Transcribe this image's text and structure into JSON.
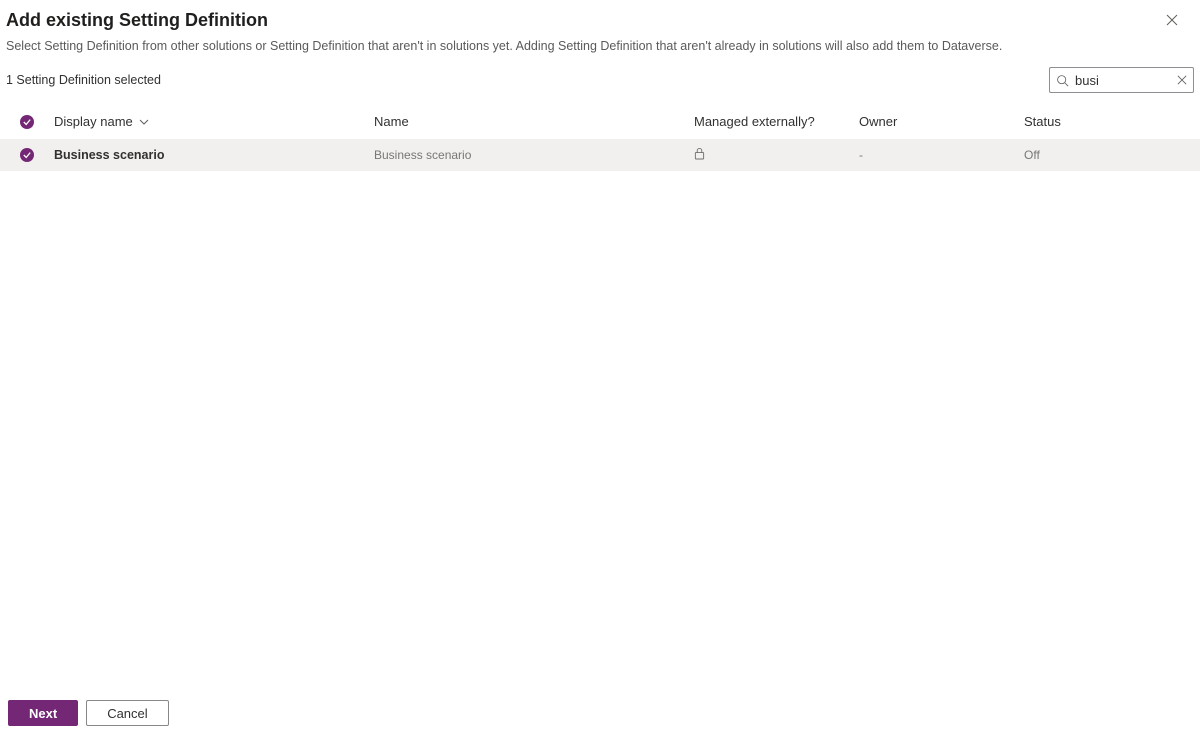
{
  "header": {
    "title": "Add existing Setting Definition",
    "subtitle": "Select Setting Definition from other solutions or Setting Definition that aren't in solutions yet. Adding Setting Definition that aren't already in solutions will also add them to Dataverse."
  },
  "toolbar": {
    "selected_text": "1 Setting Definition selected",
    "search_value": "busi"
  },
  "columns": {
    "display_name": "Display name",
    "name": "Name",
    "managed_externally": "Managed externally?",
    "owner": "Owner",
    "status": "Status"
  },
  "rows": [
    {
      "display_name": "Business scenario",
      "name": "Business scenario",
      "managed_externally": "locked",
      "owner": "-",
      "status": "Off"
    }
  ],
  "footer": {
    "next": "Next",
    "cancel": "Cancel"
  }
}
